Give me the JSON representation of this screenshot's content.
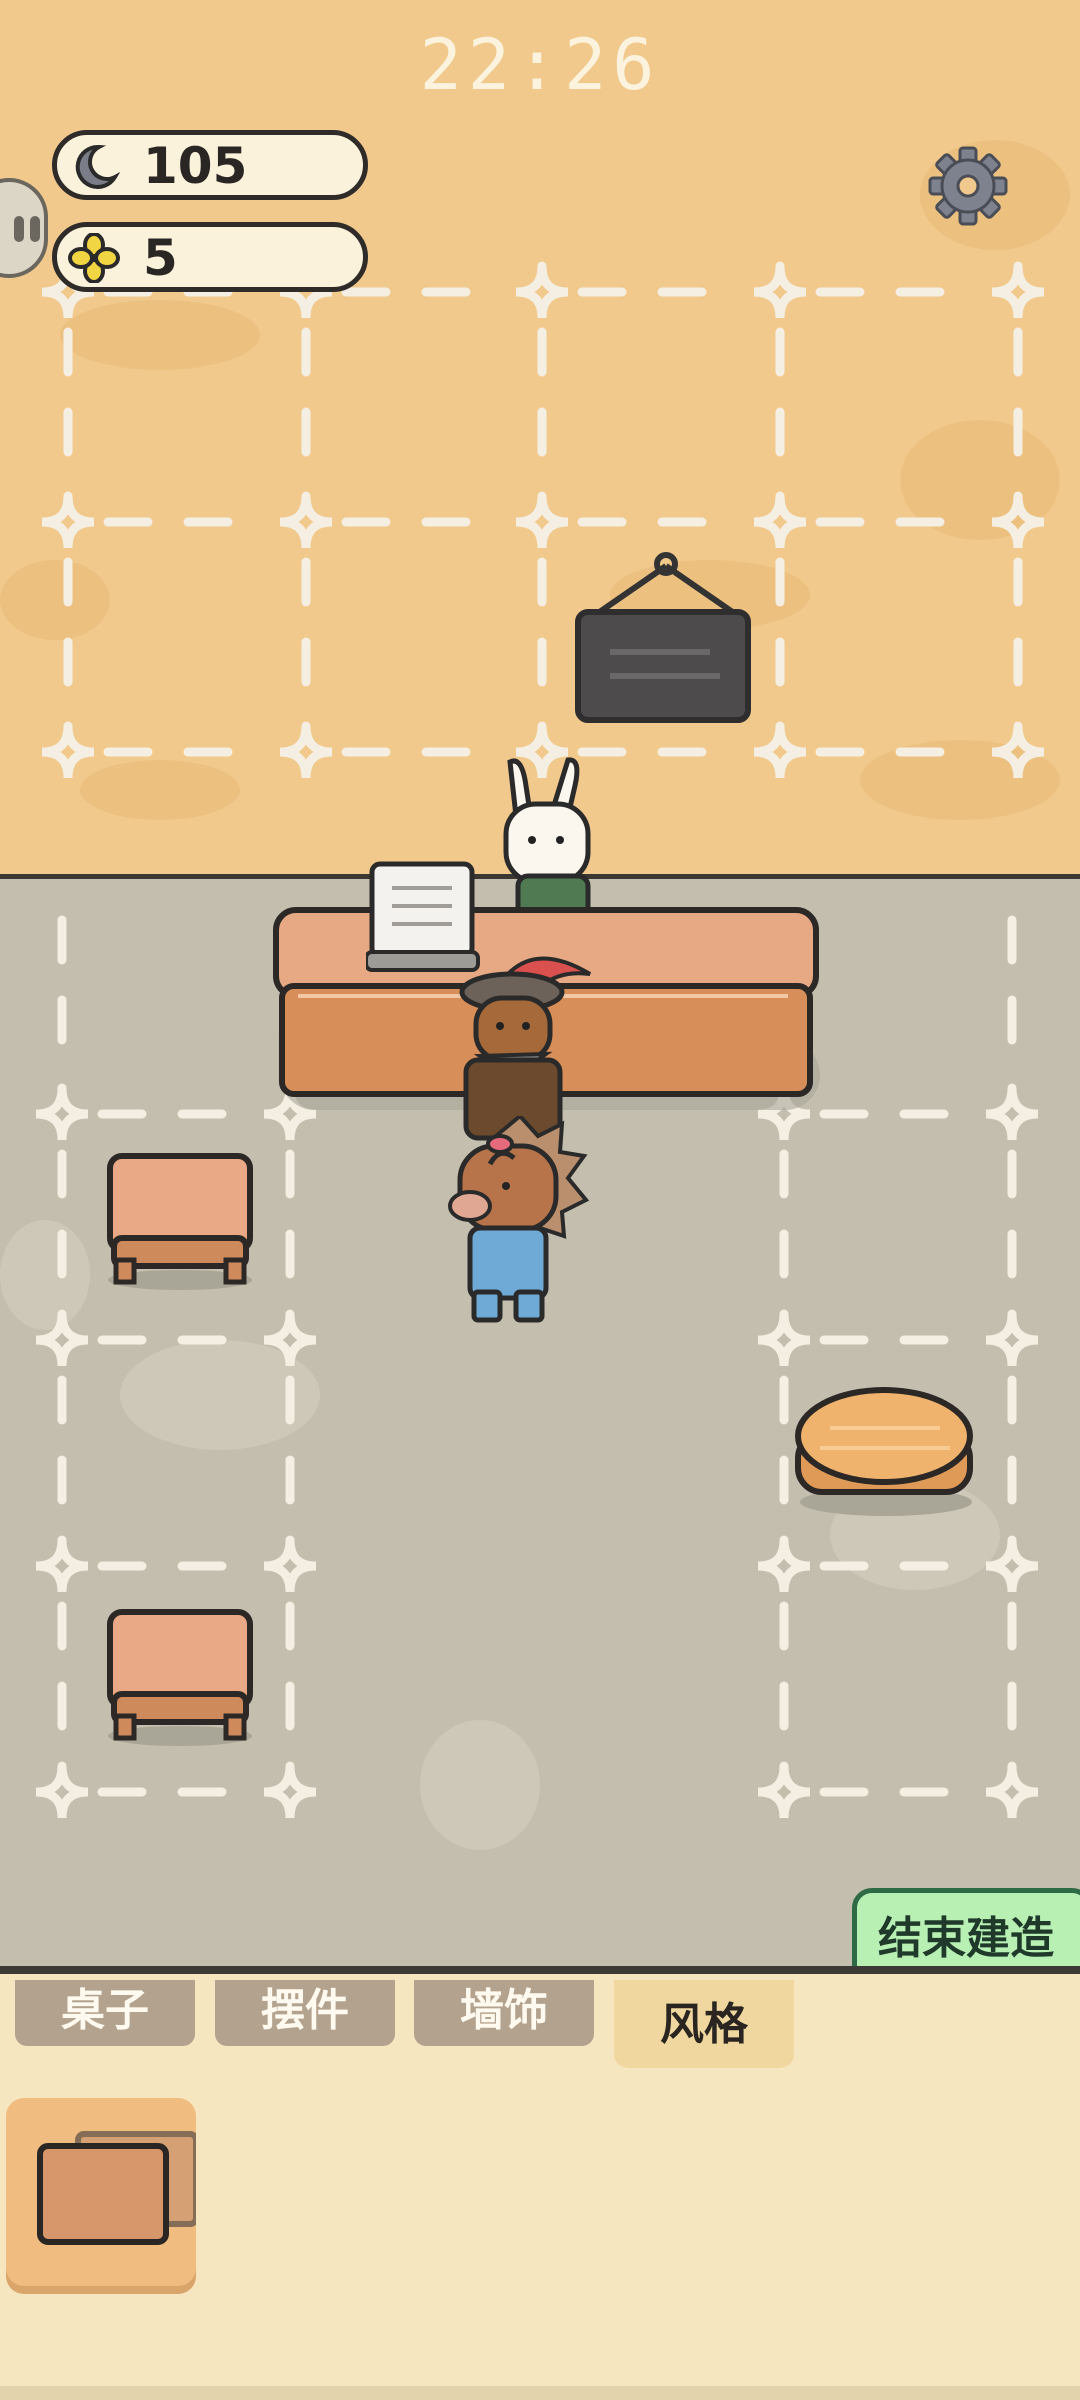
{
  "status_bar": {
    "time": "22:26"
  },
  "resources": {
    "moon": {
      "icon": "moon-icon",
      "value": "105"
    },
    "clover": {
      "icon": "clover-icon",
      "value": "5"
    }
  },
  "buttons": {
    "end_build": "结束建造",
    "settings_icon": "gear-icon"
  },
  "tabs": [
    {
      "label": "桌子",
      "active": false
    },
    {
      "label": "摆件",
      "active": false
    },
    {
      "label": "墙饰",
      "active": false
    },
    {
      "label": "风格",
      "active": true
    }
  ],
  "palette": {
    "wall": "#f1c98c",
    "floor": "#c3beae",
    "end_button": "#b8f0b4",
    "panel": "#f6e6c0",
    "tab": "#b3a28d",
    "tab_active": "#efd79f"
  }
}
